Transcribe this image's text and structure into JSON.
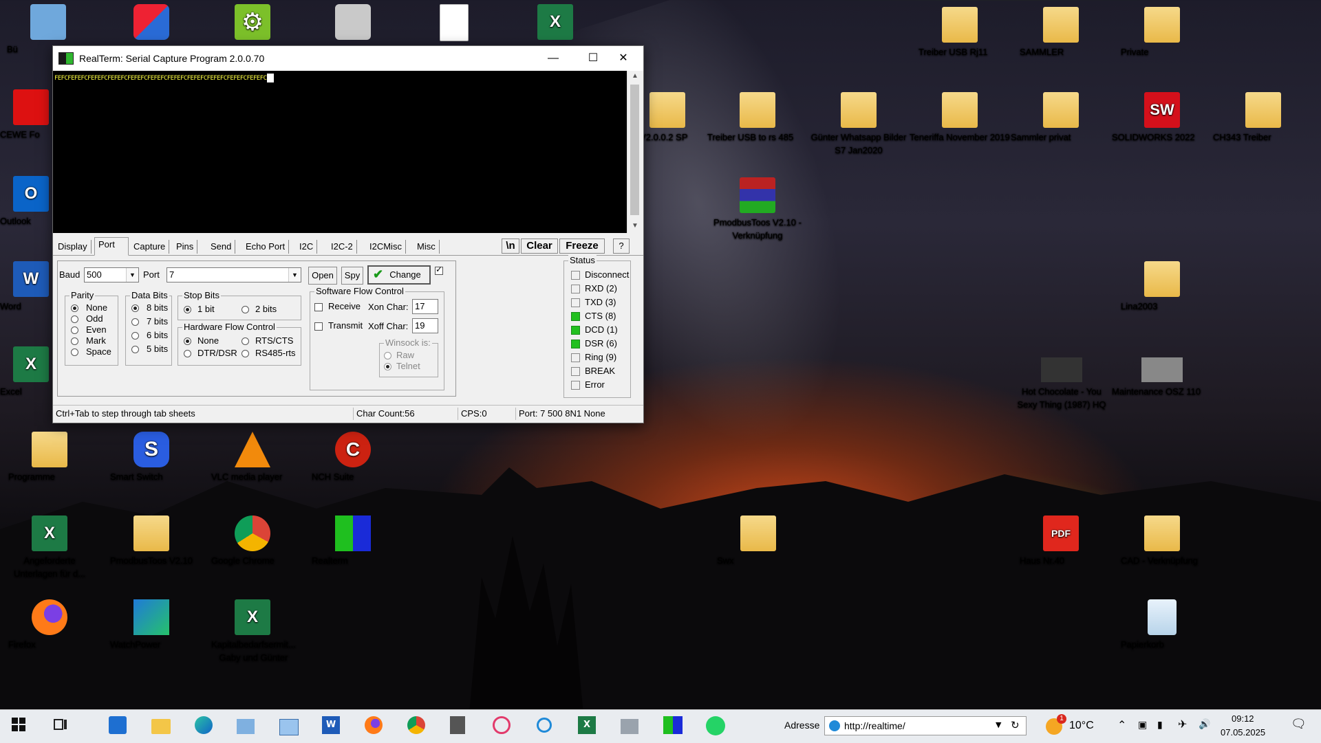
{
  "desktop": {
    "icons": [
      {
        "label": "Bü",
        "icon": "computer-icon"
      },
      {
        "label": "",
        "icon": "security-shield-icon"
      },
      {
        "label": "",
        "icon": "gear-icon"
      },
      {
        "label": "",
        "icon": "camera-icon"
      },
      {
        "label": "",
        "icon": "document-icon"
      },
      {
        "label": "",
        "icon": "excel-icon"
      },
      {
        "label": "Treiber USB Rj11",
        "icon": "folder-icon"
      },
      {
        "label": "SAMMLER",
        "icon": "folder-icon"
      },
      {
        "label": "Private",
        "icon": "folder-icon"
      },
      {
        "label": "CEWE Fo",
        "icon": "cewe-icon"
      },
      {
        "label": "Outlook",
        "icon": "outlook-icon"
      },
      {
        "label": "Word",
        "icon": "word-icon"
      },
      {
        "label": "Excel",
        "icon": "excel-icon"
      },
      {
        "label": "s V2.0.0.2 SP",
        "icon": "folder-icon"
      },
      {
        "label": "Treiber USB to rs 485",
        "icon": "folder-icon"
      },
      {
        "label": "Günter Whatsapp Bilder S7 Jan2020",
        "icon": "folder-icon"
      },
      {
        "label": "Teneriffa November 2019",
        "icon": "folder-icon"
      },
      {
        "label": "Sammler privat",
        "icon": "folder-icon"
      },
      {
        "label": "SOLIDWORKS 2022",
        "icon": "solidworks-icon"
      },
      {
        "label": "CH343 Treiber",
        "icon": "folder-icon"
      },
      {
        "label": "PmodbusToos V2.10 - Verknüpfung",
        "icon": "winrar-icon"
      },
      {
        "label": "Lina2003",
        "icon": "folder-icon"
      },
      {
        "label": "Hot Chocolate - You Sexy Thing (1987) HQ",
        "icon": "video-icon"
      },
      {
        "label": "Maintenance OSZ 110",
        "icon": "video-icon"
      },
      {
        "label": "Programme",
        "icon": "folder-icon"
      },
      {
        "label": "Smart Switch",
        "icon": "smart-switch-icon"
      },
      {
        "label": "VLC media player",
        "icon": "vlc-icon"
      },
      {
        "label": "NCH Suite",
        "icon": "nch-icon"
      },
      {
        "label": "Angeforderte Unterlagen für d...",
        "icon": "excel-icon"
      },
      {
        "label": "PmodbusToos V2.10",
        "icon": "folder-icon"
      },
      {
        "label": "Google Chrome",
        "icon": "chrome-icon"
      },
      {
        "label": "Realterm",
        "icon": "realterm-icon"
      },
      {
        "label": "Swx",
        "icon": "folder-icon"
      },
      {
        "label": "Haus Nr.40",
        "icon": "pdf-icon"
      },
      {
        "label": "CAD - Verknüpfung",
        "icon": "folder-icon"
      },
      {
        "label": "Firefox",
        "icon": "firefox-icon"
      },
      {
        "label": "WatchPower",
        "icon": "watchpower-icon"
      },
      {
        "label": "Kapitalbedarfsermit... Gaby und Günter",
        "icon": "excel-icon"
      },
      {
        "label": "Papierkorb",
        "icon": "recycle-bin-icon"
      }
    ]
  },
  "window": {
    "title": "RealTerm: Serial Capture Program 2.0.0.70",
    "terminal_text": "FEFCFEFEFCFEFEFCFEFEFCFEFEFCFEFEFCFEFEFCFEFEFCFEFEFCFEFEFCFEFEFC",
    "tabs": [
      "Display",
      "Port",
      "Capture",
      "Pins",
      "Send",
      "Echo Port",
      "I2C",
      "I2C-2",
      "I2CMisc",
      "Misc"
    ],
    "newline_label": "\\n",
    "clear_label": "Clear",
    "freeze_label": "Freeze",
    "help_label": "?",
    "port": {
      "baud_label": "Baud",
      "baud_value": "500",
      "port_label": "Port",
      "port_value": "7",
      "open_label": "Open",
      "spy_label": "Spy",
      "change_label": "Change",
      "parity_title": "Parity",
      "parity_options": [
        "None",
        "Odd",
        "Even",
        "Mark",
        "Space"
      ],
      "databits_title": "Data Bits",
      "databits_options": [
        "8 bits",
        "7 bits",
        "6 bits",
        "5 bits"
      ],
      "stopbits_title": "Stop Bits",
      "stopbits_options": [
        "1 bit",
        "2 bits"
      ],
      "hwflow_title": "Hardware Flow Control",
      "hwflow_options": [
        "None",
        "RTS/CTS",
        "DTR/DSR",
        "RS485-rts"
      ],
      "swflow_title": "Software Flow Control",
      "receive_label": "Receive",
      "transmit_label": "Transmit",
      "xon_label": "Xon Char:",
      "xon_value": "17",
      "xoff_label": "Xoff Char:",
      "xoff_value": "19",
      "winsock_title": "Winsock is:",
      "winsock_options": [
        "Raw",
        "Telnet"
      ]
    },
    "status": {
      "title": "Status",
      "items": [
        {
          "label": "Disconnect",
          "on": false
        },
        {
          "label": "RXD (2)",
          "on": false
        },
        {
          "label": "TXD (3)",
          "on": false
        },
        {
          "label": "CTS (8)",
          "on": true
        },
        {
          "label": "DCD (1)",
          "on": true
        },
        {
          "label": "DSR (6)",
          "on": true
        },
        {
          "label": "Ring (9)",
          "on": false
        },
        {
          "label": "BREAK",
          "on": false
        },
        {
          "label": "Error",
          "on": false
        }
      ]
    },
    "statusbar": {
      "hint": "Ctrl+Tab to step through tab sheets",
      "char_count": "Char Count:56",
      "cps": "CPS:0",
      "port_info": "Port: 7 500 8N1 None"
    }
  },
  "taskbar": {
    "address_label": "Adresse",
    "address_value": "http://realtime/",
    "temperature": "10°C",
    "weather_badge": "1",
    "time": "09:12",
    "date": "07.05.2025"
  },
  "colors": {
    "terminal_bg": "#000000",
    "terminal_text": "#ffff40",
    "led_on": "#22c01f",
    "change_check": "#1a9a1a"
  }
}
